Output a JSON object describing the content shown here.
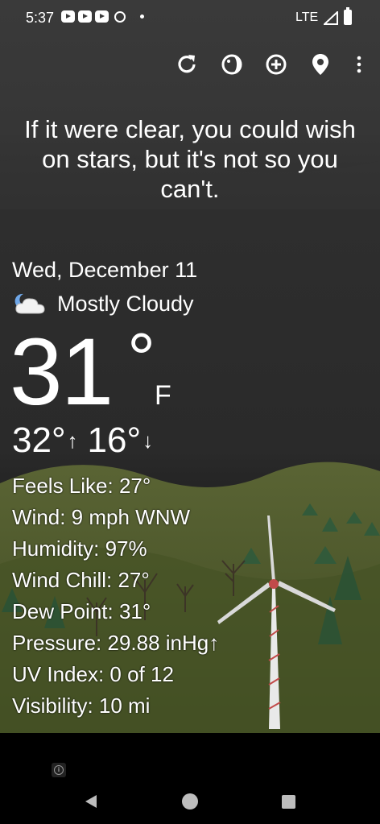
{
  "status_bar": {
    "time": "5:37",
    "network": "LTE"
  },
  "toolbar": {
    "icons": [
      "refresh-icon",
      "theme-icon",
      "add-location-icon",
      "location-pin-icon",
      "overflow-menu-icon"
    ]
  },
  "quote": "If it were clear, you could wish on stars, but it's not so you can't.",
  "weather": {
    "date": "Wed, December 11",
    "condition": "Mostly Cloudy",
    "condition_icon": "partly-cloudy-night-icon",
    "temperature": "31",
    "degree": "°",
    "unit": "F",
    "high": "32°",
    "high_arrow": "↑",
    "low": "16°",
    "low_arrow": "↓"
  },
  "details": [
    "Feels Like:  27°",
    "Wind:  9 mph WNW",
    "Humidity:  97%",
    "Wind Chill:  27°",
    "Dew Point:  31°",
    "Pressure:  29.88 inHg↑",
    "UV Index:  0 of 12",
    "Visibility:  10 mi"
  ],
  "colors": {
    "background": "#2a2a2a",
    "grass": "#4c5a2c",
    "text": "#ffffff"
  }
}
